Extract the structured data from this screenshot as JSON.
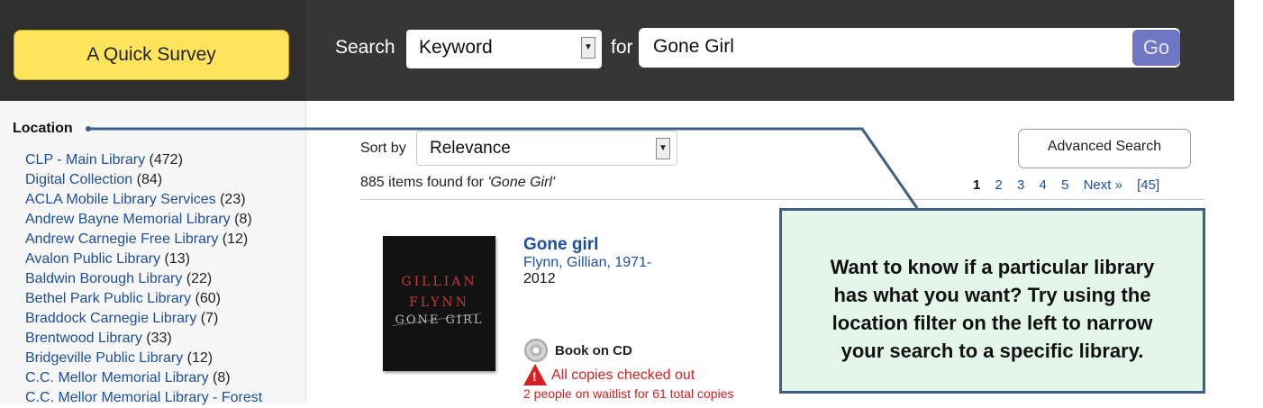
{
  "header": {
    "survey_label": "A Quick Survey",
    "search_label": "Search",
    "search_type": "Keyword",
    "for_label": "for",
    "query": "Gone Girl",
    "go_label": "Go"
  },
  "sidebar": {
    "title": "Location",
    "items": [
      {
        "name": "CLP - Main Library",
        "count": "(472)"
      },
      {
        "name": "Digital Collection",
        "count": "(84)"
      },
      {
        "name": "ACLA Mobile Library Services",
        "count": "(23)"
      },
      {
        "name": "Andrew Bayne Memorial Library",
        "count": "(8)"
      },
      {
        "name": "Andrew Carnegie Free Library",
        "count": "(12)"
      },
      {
        "name": "Avalon Public Library",
        "count": "(13)"
      },
      {
        "name": "Baldwin Borough Library",
        "count": "(22)"
      },
      {
        "name": "Bethel Park Public Library",
        "count": "(60)"
      },
      {
        "name": "Braddock Carnegie Library",
        "count": "(7)"
      },
      {
        "name": "Brentwood Library",
        "count": "(33)"
      },
      {
        "name": "Bridgeville Public Library",
        "count": "(12)"
      },
      {
        "name": "C.C. Mellor Memorial Library",
        "count": "(8)"
      },
      {
        "name": "C.C. Mellor Memorial Library - Forest",
        "count": ""
      }
    ]
  },
  "results": {
    "sort_label": "Sort by",
    "sort_value": "Relevance",
    "advanced_label": "Advanced Search",
    "found_prefix": "885 items found for ",
    "found_query": "'Gone Girl'",
    "pager": [
      "1",
      "2",
      "3",
      "4",
      "5",
      "Next »",
      "[45]"
    ]
  },
  "item": {
    "title": "Gone girl",
    "author": "Flynn, Gillian, 1971-",
    "year": "2012",
    "cover_author": "GILLIAN",
    "cover_author2": "FLYNN",
    "cover_title": "GONE GIRL",
    "format": "Book on CD",
    "status": "All copies checked out",
    "waitlist": "2 people on waitlist for 61 total copies"
  },
  "annotation": {
    "text": "Want to know if a particular library\nhas what you want?  Try using the\nlocation filter on the left to narrow\nyour search to a specific library."
  },
  "colors": {
    "header_dark": "#363636",
    "survey_yellow": "#ffe45c",
    "go_button": "#6f76c4",
    "link_blue": "#1d4f9c",
    "alert_red": "#d42020",
    "callout_fill": "#e4f5ea",
    "callout_border": "#3e5f8a"
  },
  "icons": {
    "format": "cd-icon",
    "status": "warning-icon"
  }
}
